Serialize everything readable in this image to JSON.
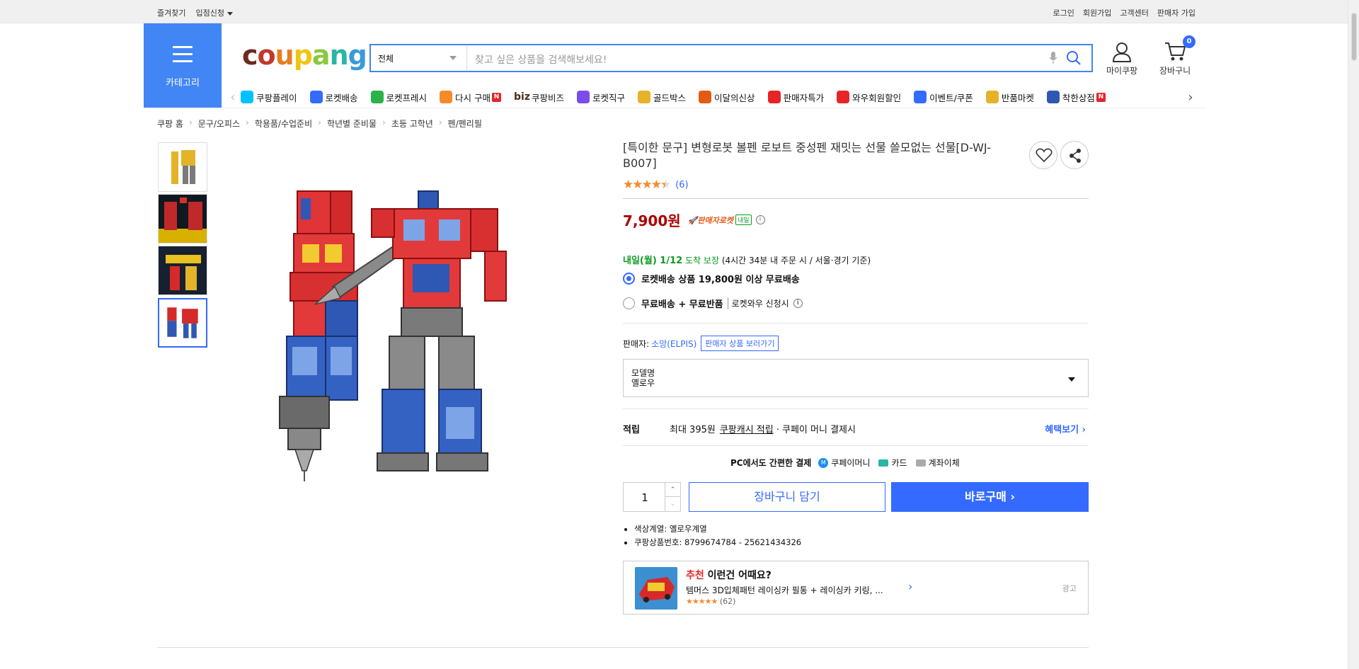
{
  "topbar": {
    "bookmark": "즐겨찾기",
    "vendor_apply": "입점신청",
    "login": "로그인",
    "signup": "회원가입",
    "customer_center": "고객센터",
    "seller_signup": "판매자 가입"
  },
  "header": {
    "category_label": "카테고리",
    "logo": "coupang",
    "search_category": "전체",
    "search_placeholder": "찾고 싶은 상품을 검색해보세요!",
    "my_coupang": "마이쿠팡",
    "cart": "장바구니",
    "cart_count": "0"
  },
  "nav": {
    "items": [
      {
        "label": "쿠팡플레이",
        "icon": "play-icon"
      },
      {
        "label": "로켓배송",
        "icon": "rocket-icon"
      },
      {
        "label": "로켓프레시",
        "icon": "rocket-fresh-icon"
      },
      {
        "label": "다시 구매",
        "icon": "rebuy-icon",
        "badge": "N"
      },
      {
        "label": "쿠팡비즈",
        "icon": "biz-icon",
        "prefix": "biz"
      },
      {
        "label": "로켓직구",
        "icon": "rocket-direct-icon"
      },
      {
        "label": "골드박스",
        "icon": "goldbox-icon"
      },
      {
        "label": "이달의신상",
        "icon": "new-icon"
      },
      {
        "label": "판매자특가",
        "icon": "seller-sale-icon"
      },
      {
        "label": "와우회원할인",
        "icon": "wow-icon"
      },
      {
        "label": "이벤트/쿠폰",
        "icon": "event-icon"
      },
      {
        "label": "반품마켓",
        "icon": "return-market-icon"
      },
      {
        "label": "착한상점",
        "icon": "good-store-icon",
        "badge": "N"
      }
    ]
  },
  "breadcrumb": [
    "쿠팡 홈",
    "문구/오피스",
    "학용품/수업준비",
    "학년별 준비물",
    "초등 고학년",
    "펜/펜리필"
  ],
  "product": {
    "title": "[특이한 문구] 변형로봇 볼펜 로보트 중성펜 재밋는 선물 쓸모없는 선물[D-WJ-B007]",
    "rating": 4.5,
    "review_count": "(6)",
    "price": "7,900원",
    "rocket_label": "판매자로켓",
    "tomorrow_label": "내일",
    "delivery_date": "내일(월) 1/12",
    "delivery_guarantee": "도착 보장",
    "delivery_note": "(4시간 34분 내 주문 시 / 서울·경기 기준)",
    "option1": "로켓배송 상품 19,800원 이상 무료배송",
    "option2": "무료배송 + 무료반품",
    "option2_note": "로켓와우 신청시",
    "seller_label": "판매자:",
    "seller_name": "소망(ELPIS)",
    "seller_btn": "판매자 상품 보러가기",
    "model_label": "모델명",
    "model_value": "옐로우",
    "reward_label": "적립",
    "reward_text_1": "최대 395원",
    "reward_text_2": "쿠팡캐시 적립",
    "reward_text_3": "· 쿠페이 머니 결제시",
    "benefit_link": "혜택보기",
    "pc_pay": "PC에서도 간편한 결제",
    "pay_money": "쿠페이머니",
    "pay_card": "카드",
    "pay_transfer": "계좌이체",
    "qty": "1",
    "add_cart": "장바구니 담기",
    "buy_now": "바로구매",
    "spec_color": "색상계열: 옐로우계열",
    "spec_id": "쿠팡상품번호: 8799674784 - 25621434326"
  },
  "recommend": {
    "tag": "추천",
    "heading": "이런건 어때요?",
    "name": "템머스 3D입체패턴 레이싱카 필통 + 레이싱카 키링, ...",
    "rating": 5,
    "count": "(62)",
    "ad": "광고"
  }
}
